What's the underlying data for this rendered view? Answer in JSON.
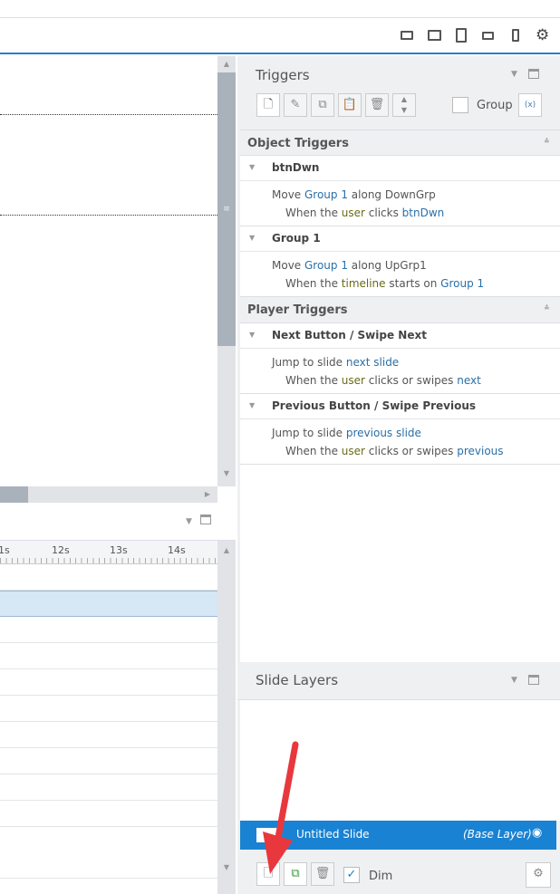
{
  "toolbar": {
    "devices": [
      "desktop-icon",
      "tablet-landscape-icon",
      "tablet-portrait-icon",
      "phone-landscape-icon",
      "phone-portrait-icon"
    ]
  },
  "timeline": {
    "ticks": [
      "1s",
      "12s",
      "13s",
      "14s"
    ]
  },
  "triggers": {
    "title": "Triggers",
    "group_label": "Group",
    "group_checked": false,
    "object_section": "Object Triggers",
    "player_section": "Player Triggers",
    "objects": [
      {
        "name": "btnDwn",
        "l1": [
          "Move ",
          "Group 1",
          " along DownGrp"
        ],
        "l2": [
          "When the ",
          "user",
          " clicks ",
          "btnDwn"
        ]
      },
      {
        "name": "Group 1",
        "l1": [
          "Move ",
          "Group 1",
          " along UpGrp1"
        ],
        "l2": [
          "When the ",
          "timeline",
          " starts on ",
          "Group 1"
        ]
      }
    ],
    "players": [
      {
        "name": "Next Button / Swipe Next",
        "l1": [
          "Jump to slide ",
          "next slide",
          ""
        ],
        "l2": [
          "When the ",
          "user",
          " clicks or swipes ",
          "next"
        ]
      },
      {
        "name": "Previous Button / Swipe Previous",
        "l1": [
          "Jump to slide ",
          "previous slide",
          ""
        ],
        "l2": [
          "When the ",
          "user",
          " clicks or swipes ",
          "previous"
        ]
      }
    ]
  },
  "layers": {
    "title": "Slide Layers",
    "selected_name": "Untitled Slide",
    "selected_tag": "(Base Layer)",
    "dim_label": "Dim",
    "dim_checked": true
  },
  "colors": {
    "accent": "#1a82d2",
    "annotation_arrow": "#e8383d"
  }
}
